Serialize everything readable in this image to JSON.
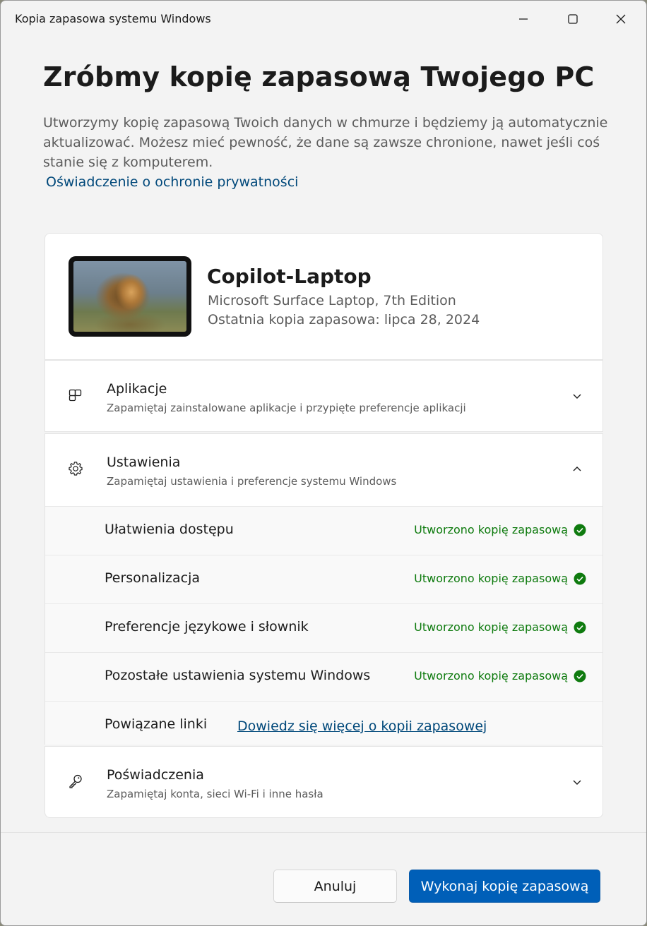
{
  "window": {
    "title": "Kopia zapasowa systemu Windows",
    "controls": {
      "minimize": "minimize-icon",
      "maximize": "maximize-icon",
      "close": "close-icon"
    }
  },
  "header": {
    "heading": "Zróbmy kopię zapasową Twojego PC",
    "description": "Utworzymy kopię zapasową Twoich danych w chmurze i będziemy ją automatycznie aktualizować. Możesz mieć pewność, że dane są zawsze chronione, nawet jeśli coś stanie się z komputerem.",
    "privacy_link": "Oświadczenie o ochronie prywatności"
  },
  "device": {
    "name": "Copilot-Laptop",
    "model": "Microsoft Surface Laptop, 7th Edition",
    "last_backup": "Ostatnia kopia zapasowa: lipca 28, 2024"
  },
  "sections": {
    "apps": {
      "title": "Aplikacje",
      "subtitle": "Zapamiętaj zainstalowane aplikacje i przypięte preferencje aplikacji",
      "icon": "apps-icon",
      "expanded": false
    },
    "settings": {
      "title": "Ustawienia",
      "subtitle": "Zapamiętaj ustawienia i preferencje systemu Windows",
      "icon": "gear-icon",
      "expanded": true,
      "items": [
        {
          "label": "Ułatwienia dostępu",
          "status": "Utworzono kopię zapasową"
        },
        {
          "label": "Personalizacja",
          "status": "Utworzono kopię zapasową"
        },
        {
          "label": "Preferencje językowe i słownik",
          "status": "Utworzono kopię zapasową"
        },
        {
          "label": "Pozostałe ustawienia systemu Windows",
          "status": "Utworzono kopię zapasową"
        }
      ],
      "related": {
        "label": "Powiązane linki",
        "link": "Dowiedz się więcej o kopii zapasowej"
      }
    },
    "credentials": {
      "title": "Poświadczenia",
      "subtitle": "Zapamiętaj konta, sieci Wi-Fi i inne hasła",
      "icon": "key-icon",
      "expanded": false
    }
  },
  "footer": {
    "cancel_label": "Anuluj",
    "primary_label": "Wykonaj kopię zapasową"
  },
  "colors": {
    "accent": "#005fb8",
    "link": "#00487a",
    "success": "#0f7b0f"
  }
}
